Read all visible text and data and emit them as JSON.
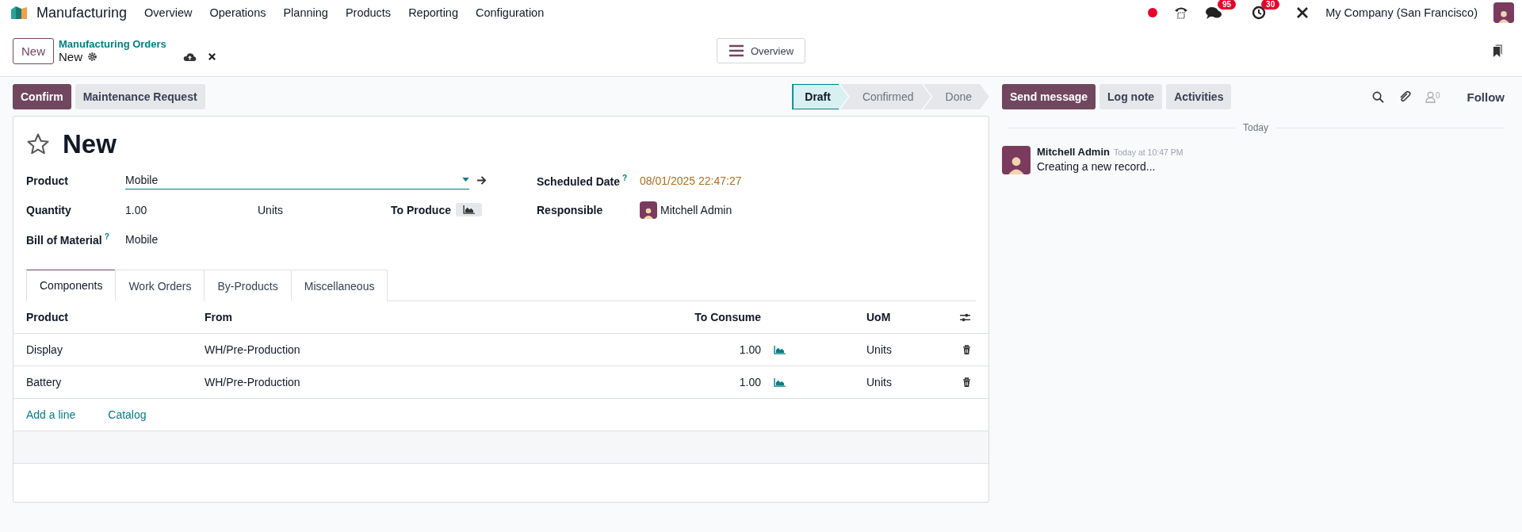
{
  "navbar": {
    "app": "Manufacturing",
    "menu": [
      "Overview",
      "Operations",
      "Planning",
      "Products",
      "Reporting",
      "Configuration"
    ],
    "messages_badge": "95",
    "activities_badge": "30",
    "company": "My Company (San Francisco)"
  },
  "control_panel": {
    "new_button": "New",
    "breadcrumb": "Manufacturing Orders",
    "record": "New",
    "view_button": "Overview"
  },
  "actions": [
    {
      "label": "Confirm",
      "primary": true
    },
    {
      "label": "Maintenance Request",
      "primary": false
    }
  ],
  "stages": [
    {
      "label": "Draft",
      "selected": true
    },
    {
      "label": "Confirmed",
      "selected": false
    },
    {
      "label": "Done",
      "selected": false
    }
  ],
  "form": {
    "title": "New",
    "starred": false,
    "product": {
      "label": "Product",
      "value": "Mobile"
    },
    "quantity": {
      "label": "Quantity",
      "value": "1.00",
      "uom": "Units",
      "produce_label": "To Produce"
    },
    "bom": {
      "label": "Bill of Material",
      "help": "?",
      "value": "Mobile"
    },
    "scheduled": {
      "label": "Scheduled Date",
      "help": "?",
      "value": "08/01/2025 22:47:27"
    },
    "responsible": {
      "label": "Responsible",
      "value": "Mitchell Admin"
    }
  },
  "tabs": [
    {
      "label": "Components",
      "selected": true
    },
    {
      "label": "Work Orders",
      "selected": false
    },
    {
      "label": "By-Products",
      "selected": false
    },
    {
      "label": "Miscellaneous",
      "selected": false
    }
  ],
  "table": {
    "columns": [
      "Product",
      "From",
      "To Consume",
      "UoM"
    ],
    "rows": [
      {
        "product": "Display",
        "from": "WH/Pre-Production",
        "to_consume": "1.00",
        "uom": "Units"
      },
      {
        "product": "Battery",
        "from": "WH/Pre-Production",
        "to_consume": "1.00",
        "uom": "Units"
      }
    ],
    "links": [
      "Add a line",
      "Catalog"
    ]
  },
  "chatter": {
    "buttons": [
      {
        "label": "Send message",
        "primary": true
      },
      {
        "label": "Log note",
        "primary": false
      },
      {
        "label": "Activities",
        "primary": false
      }
    ],
    "follower_count": "0",
    "follow": "Follow",
    "separator": "Today",
    "message": {
      "author": "Mitchell Admin",
      "time": "Today at 10:47 PM",
      "body": "Creating a new record..."
    }
  }
}
